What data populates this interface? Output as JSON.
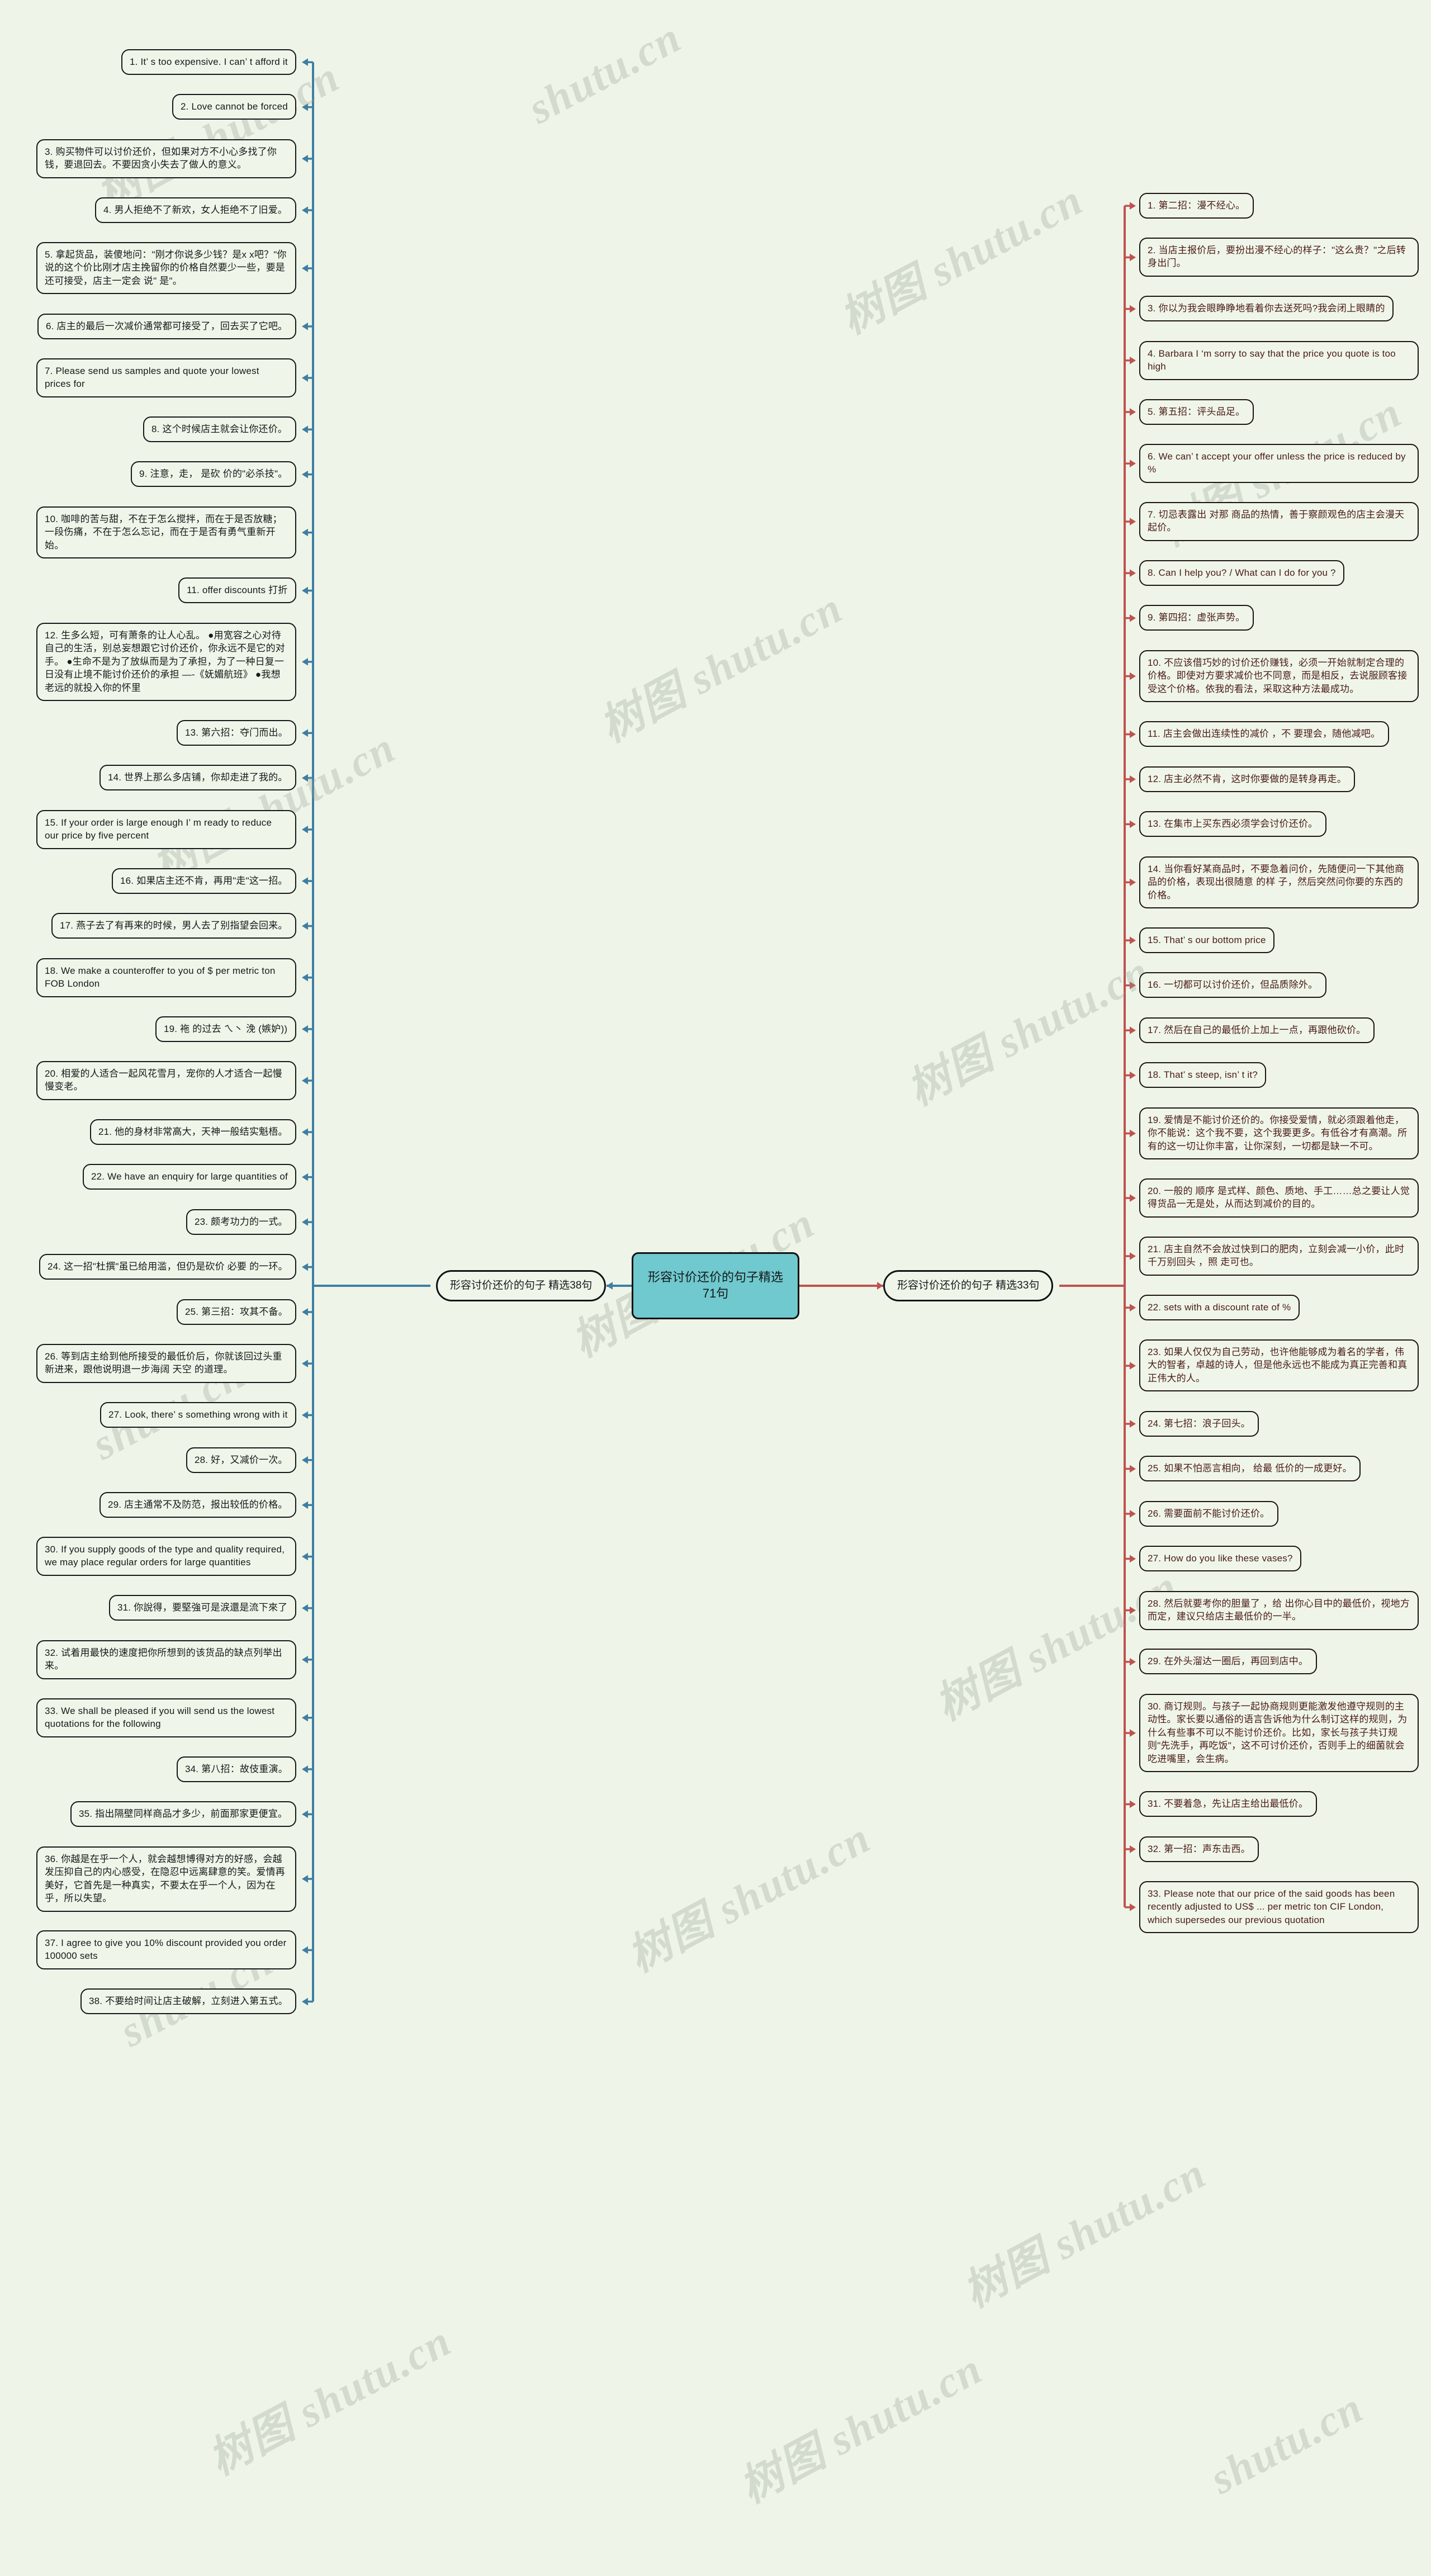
{
  "root": {
    "title": "形容讨价还价的句子精选71句",
    "fill": "#6fc9ce"
  },
  "branches": [
    {
      "id": "left",
      "label": "形容讨价还价的句子 精选38句",
      "line_color": "#3f7ea3"
    },
    {
      "id": "right",
      "label": "形容讨价还价的句子 精选33句",
      "line_color": "#c0524f"
    }
  ],
  "left_items": [
    "1. It’ s too expensive. I can’ t afford it",
    "2. Love cannot be forced",
    "3. 购买物件可以讨价还价，但如果对方不小心多找了你钱，要退回去。不要因贪小失去了做人的意义。",
    "4. 男人拒绝不了新欢，女人拒绝不了旧爱。",
    "5. 拿起货品，装傻地问：\"刚才你说多少钱？是x x吧？\"你说的这个价比刚才店主挽留你的价格自然要少一些，要是还可接受，店主一定会 说\" 是\"。",
    "6. 店主的最后一次减价通常都可接受了，回去买了它吧。",
    "7. Please send us samples and quote your lowest prices for",
    "8. 这个时候店主就会让你还价。",
    "9. 注意，走， 是砍 价的\"必杀技\"。",
    "10. 咖啡的苦与甜，不在于怎么搅拌，而在于是否放糖；一段伤痛，不在于怎么忘记，而在于是否有勇气重新开始。",
    "11. offer discounts 打折",
    "12. 生多么短，可有萧条的让人心乱。 ●用宽容之心对待自己的生活，别总妄想跟它讨价还价，你永远不是它的对手。 ●生命不是为了放纵而是为了承担，为了一种日复一日没有止境不能讨价还价的承担 —-《妩媚航班》 ●我想老远的就投入你的怀里",
    "13. 第六招：夺门而出。",
    "14. 世界上那么多店铺，你却走进了我的。",
    "15. If your order is large enough I’ m ready to reduce our price by five percent",
    "16. 如果店主还不肯，再用\"走\"这一招。",
    "17. 燕子去了有再来的时候，男人去了别指望会回来。",
    "18. We make a counteroffer to you of $ per metric ton FOB London",
    "19. 袘 的过去 ㄟ丶 浼 (嫉妒))",
    "20. 相爱的人适合一起风花雪月，宠你的人才适合一起慢慢变老。",
    "21. 他的身材非常高大，天神一般结实魁梧。",
    "22. We have an enquiry for large quantities of",
    "23. 颇考功力的一式。",
    "24. 这一招\"杜撰\"虽已给用滥，但仍是砍价 必要 的一环。",
    "25. 第三招：攻其不备。",
    "26. 等到店主给到他所接受的最低价后，你就该回过头重新进来，跟他说明退一步海阔 天空 的道理。",
    "27. Look, there’ s something wrong with it",
    "28. 好，又减价一次。",
    "29. 店主通常不及防范，报出较低的价格。",
    "30. If you supply goods of the type and quality required, we may place regular orders for large quantities",
    "31. 你說得，要堅強可是涙還是流下來了",
    "32. 试着用最快的速度把你所想到的该货品的缺点列举出来。",
    "33. We shall be pleased if you will send us the lowest quotations for the following",
    "34. 第八招：故伎重演。",
    "35. 指出隔壁同样商品才多少，前面那家更便宜。",
    "36. 你越是在乎一个人，就会越想博得对方的好感，会越发压抑自己的内心感受，在隐忍中远离肆意的笑。爱情再美好，它首先是一种真实，不要太在乎一个人，因为在乎，所以失望。",
    "37. I agree to give you 10% discount provided you order 100000 sets",
    "38. 不要给时间让店主破解，立刻进入第五式。"
  ],
  "right_items": [
    "1. 第二招：漫不经心。",
    "2. 当店主报价后，要扮出漫不经心的样子：\"这么贵？\"之后转身出门。",
    "3. 你以为我会眼睁睁地看着你去送死吗?我会闭上眼睛的",
    "4. Barbara I ‘m sorry to say that the price you quote is too high",
    "5. 第五招：评头品足。",
    "6. We can’ t accept your offer unless the price is reduced by %",
    "7. 切忌表露出 对那 商品的热情，善于察颜观色的店主会漫天起价。",
    "8. Can I help you? / What can I do for you ?",
    "9. 第四招：虚张声势。",
    "10. 不应该借巧妙的讨价还价赚钱，必须一开始就制定合理的价格。即使对方要求减价也不同意，而是相反，去说服顾客接受这个价格。依我的看法，采取这种方法最成功。",
    "11. 店主会做出连续性的减价 ，不 要理会，随他减吧。",
    "12. 店主必然不肯，这时你要做的是转身再走。",
    "13. 在集市上买东西必须学会讨价还价。",
    "14. 当你看好某商品时，不要急着问价，先随便问一下其他商品的价格，表现出很随意 的样 子，然后突然问你要的东西的价格。",
    "15. That’ s our bottom price",
    "16. 一切都可以讨价还价，但品质除外。",
    "17. 然后在自己的最低价上加上一点，再跟他砍价。",
    "18. That’ s steep, isn’ t it?",
    "19. 爱情是不能讨价还价的。你接受爱情，就必须跟着他走，你不能说：这个我不要，这个我要更多。有低谷才有高潮。所有的这一切让你丰富，让你深刻，一切都是缺一不可。",
    "20. 一般的 顺序 是式样、颜色、质地、手工……总之要让人觉得货品一无是处，从而达到减价的目的。",
    "21. 店主自然不会放过快到口的肥肉，立刻会减一小价，此时千万别回头 ，照 走可也。",
    "22. sets with a discount rate of %",
    "23. 如果人仅仅为自己劳动，也许他能够成为着名的学者，伟大的智者，卓越的诗人，但是他永远也不能成为真正完善和真正伟大的人。",
    "24. 第七招：浪子回头。",
    "25. 如果不怕恶言相向， 给最 低价的一成更好。",
    "26. 需要面前不能讨价还价。",
    "27. How do you like these vases?",
    "28. 然后就要考你的胆量了 ，给 出你心目中的最低价，视地方而定，建议只给店主最低价的一半。",
    "29. 在外头溜达一圈后，再回到店中。",
    "30. 商订规则。与孩子一起协商规则更能激发他遵守规则的主动性。家长要以通俗的语言告诉他为什么制订这样的规则，为什么有些事不可以不能讨价还价。比如，家长与孩子共订规则\"先洗手，再吃饭\"，这不可讨价还价，否则手上的细菌就会吃进嘴里，会生病。",
    "31. 不要着急，先让店主给出最低价。",
    "32. 第一招：声东击西。",
    "33. Please note that our price of the said goods has been recently adjusted to US$ ... per metric ton CIF London, which supersedes our previous quotation"
  ],
  "watermarks": [
    "树图 shutu.cn",
    "shutu.cn",
    "树图 shutu.cn",
    "树图 shutu.cn",
    "树图 shutu.cn",
    "树图 shutu.cn",
    "shutu.cn",
    "树图 shutu.cn"
  ]
}
